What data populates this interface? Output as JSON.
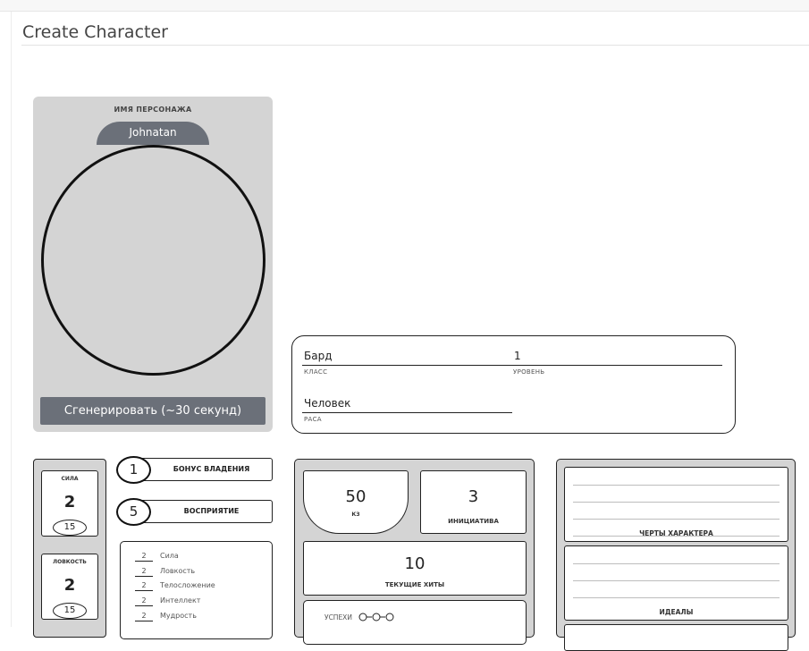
{
  "page": {
    "title": "Create Character"
  },
  "portrait": {
    "name_label": "ИМЯ ПЕРСОНАЖА",
    "name_value": "Johnatan",
    "generate_button": "Сгенерировать (~30 секунд)"
  },
  "info": {
    "class_value": "Бард",
    "class_label": "КЛАСС",
    "level_value": "1",
    "level_label": "УРОВЕНЬ",
    "race_value": "Человек",
    "race_label": "РАСА"
  },
  "attributes": [
    {
      "label": "СИЛА",
      "value": "2",
      "score": "15"
    },
    {
      "label": "ЛОВКОСТЬ",
      "value": "2",
      "score": "15"
    }
  ],
  "bonuses": [
    {
      "value": "1",
      "label": "БОНУС ВЛАДЕНИЯ"
    },
    {
      "value": "5",
      "label": "ВОСПРИЯТИЕ"
    }
  ],
  "saves": [
    {
      "value": "2",
      "label": "Сила"
    },
    {
      "value": "2",
      "label": "Ловкость"
    },
    {
      "value": "2",
      "label": "Телосложение"
    },
    {
      "value": "2",
      "label": "Интеллект"
    },
    {
      "value": "2",
      "label": "Мудрость"
    }
  ],
  "combat": {
    "armor_value": "50",
    "armor_label": "КЗ",
    "initiative_value": "3",
    "initiative_label": "ИНИЦИАТИВА",
    "hp_value": "10",
    "hp_label": "ТЕКУЩИЕ ХИТЫ",
    "successes_label": "УСПЕХИ"
  },
  "traits": {
    "traits_label": "ЧЕРТЫ ХАРАКТЕРА",
    "ideals_label": "ИДЕАЛЫ"
  }
}
